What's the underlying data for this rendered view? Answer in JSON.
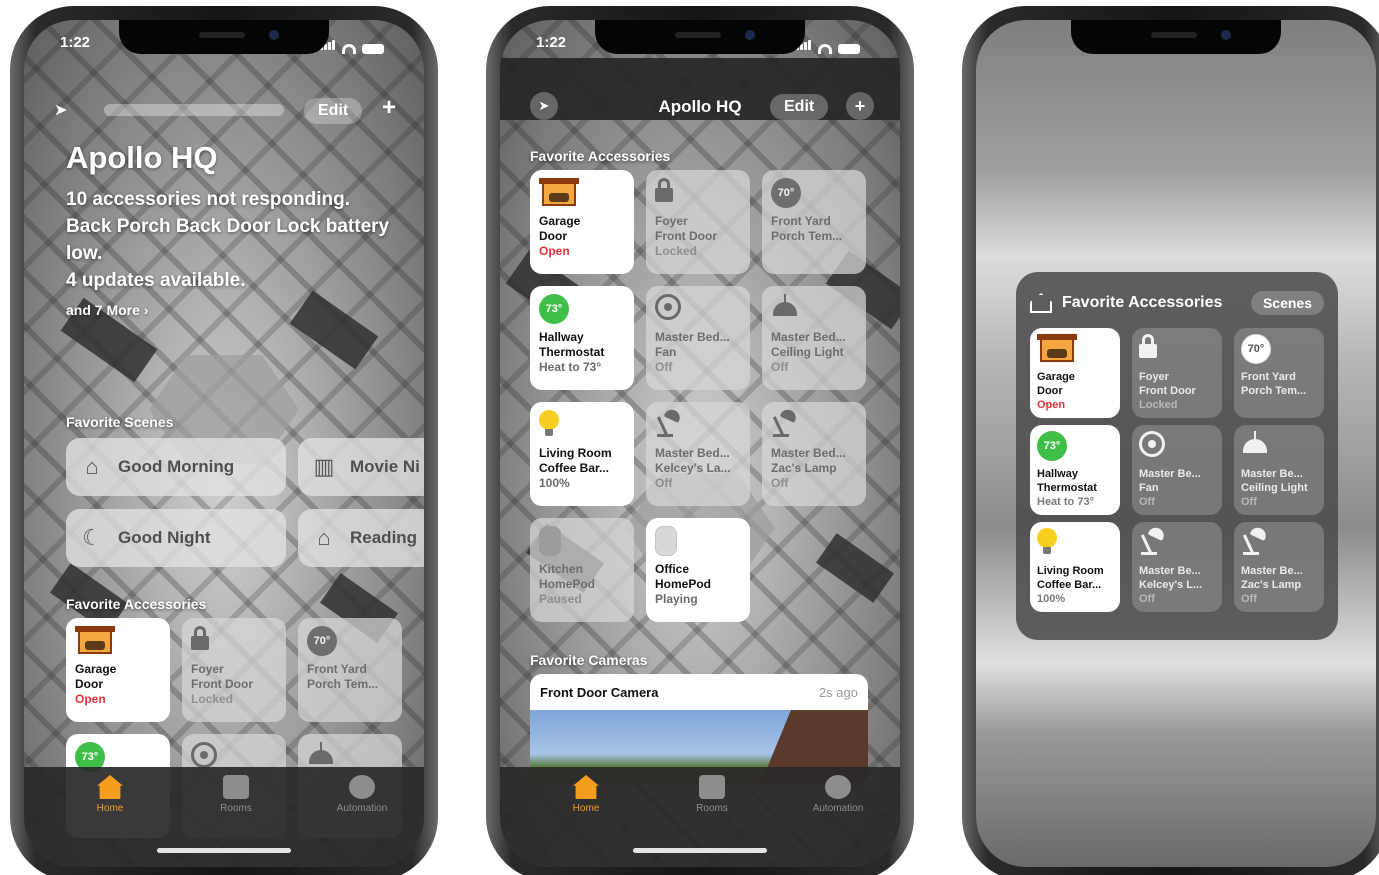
{
  "status_bar": {
    "time": "1:22"
  },
  "phone1": {
    "edit_label": "Edit",
    "add_label": "+",
    "home_name": "Apollo HQ",
    "status_lines": [
      "10 accessories not responding.",
      "Back Porch Back Door Lock battery low.",
      "4 updates available."
    ],
    "more_link": "and 7 More ›",
    "scenes_label": "Favorite Scenes",
    "scenes": [
      {
        "label": "Good Morning",
        "icon": "sunrise-house-icon"
      },
      {
        "label": "Movie Ni",
        "icon": "popcorn-icon"
      },
      {
        "label": "Good Night",
        "icon": "moon-house-icon"
      },
      {
        "label": "Reading",
        "icon": "house-icon"
      }
    ],
    "accessories_label": "Favorite Accessories"
  },
  "phone2": {
    "home_name": "Apollo HQ",
    "edit_label": "Edit",
    "add_label": "+",
    "accessories_label": "Favorite Accessories",
    "cameras_label": "Favorite Cameras",
    "camera": {
      "name": "Front Door Camera",
      "ago": "2s ago"
    }
  },
  "accessories": [
    {
      "name1": "Garage",
      "name2": "Door",
      "state": "Open",
      "on": true,
      "alert": true,
      "icon": "garage-icon"
    },
    {
      "name1": "Foyer",
      "name2": "Front Door",
      "state": "Locked",
      "on": false,
      "icon": "lock-icon"
    },
    {
      "name1": "Front Yard",
      "name2": "Porch Tem...",
      "state": "",
      "on": false,
      "icon": "temperature-icon",
      "badge": "70°"
    },
    {
      "name1": "Hallway",
      "name2": "Thermostat",
      "state": "Heat to 73°",
      "on": true,
      "icon": "thermostat-icon",
      "badge": "73°"
    },
    {
      "name1": "Master Bed...",
      "name2": "Fan",
      "state": "Off",
      "on": false,
      "icon": "fan-icon"
    },
    {
      "name1": "Master Bed...",
      "name2": "Ceiling Light",
      "state": "Off",
      "on": false,
      "icon": "pendant-light-icon"
    },
    {
      "name1": "Living Room",
      "name2": "Coffee Bar...",
      "state": "100%",
      "on": true,
      "icon": "bulb-icon"
    },
    {
      "name1": "Master Bed...",
      "name2": "Kelcey's La...",
      "state": "Off",
      "on": false,
      "icon": "desk-lamp-icon"
    },
    {
      "name1": "Master Bed...",
      "name2": "Zac's Lamp",
      "state": "Off",
      "on": false,
      "icon": "desk-lamp-icon"
    },
    {
      "name1": "Kitchen",
      "name2": "HomePod",
      "state": "Paused",
      "on": false,
      "icon": "homepod-icon"
    },
    {
      "name1": "Office",
      "name2": "HomePod",
      "state": "Playing",
      "on": true,
      "icon": "homepod-icon"
    }
  ],
  "widget": {
    "title": "Favorite Accessories",
    "scenes_label": "Scenes",
    "tiles": [
      {
        "name1": "Garage",
        "name2": "Door",
        "state": "Open",
        "on": true,
        "alert": true,
        "icon": "garage-icon"
      },
      {
        "name1": "Foyer",
        "name2": "Front Door",
        "state": "Locked",
        "on": false,
        "icon": "lock-icon"
      },
      {
        "name1": "Front Yard",
        "name2": "Porch Tem...",
        "state": "",
        "on": false,
        "icon": "temperature-icon",
        "badge": "70°"
      },
      {
        "name1": "Hallway",
        "name2": "Thermostat",
        "state": "Heat to 73°",
        "on": true,
        "icon": "thermostat-icon",
        "badge": "73°"
      },
      {
        "name1": "Master Be...",
        "name2": "Fan",
        "state": "Off",
        "on": false,
        "icon": "fan-icon"
      },
      {
        "name1": "Master Be...",
        "name2": "Ceiling Light",
        "state": "Off",
        "on": false,
        "icon": "pendant-light-icon"
      },
      {
        "name1": "Living Room",
        "name2": "Coffee Bar...",
        "state": "100%",
        "on": true,
        "icon": "bulb-icon"
      },
      {
        "name1": "Master Be...",
        "name2": "Kelcey's L...",
        "state": "Off",
        "on": false,
        "icon": "desk-lamp-icon"
      },
      {
        "name1": "Master Be...",
        "name2": "Zac's Lamp",
        "state": "Off",
        "on": false,
        "icon": "desk-lamp-icon"
      }
    ]
  },
  "tabs": [
    {
      "label": "Home",
      "icon": "home-icon",
      "active": true
    },
    {
      "label": "Rooms",
      "icon": "rooms-icon",
      "active": false
    },
    {
      "label": "Automation",
      "icon": "automation-icon",
      "active": false
    }
  ],
  "colors": {
    "accent": "#f59d1f",
    "alert": "#e8323a",
    "thermo_green": "#3fbf48",
    "bulb_yellow": "#f7cf1f"
  }
}
